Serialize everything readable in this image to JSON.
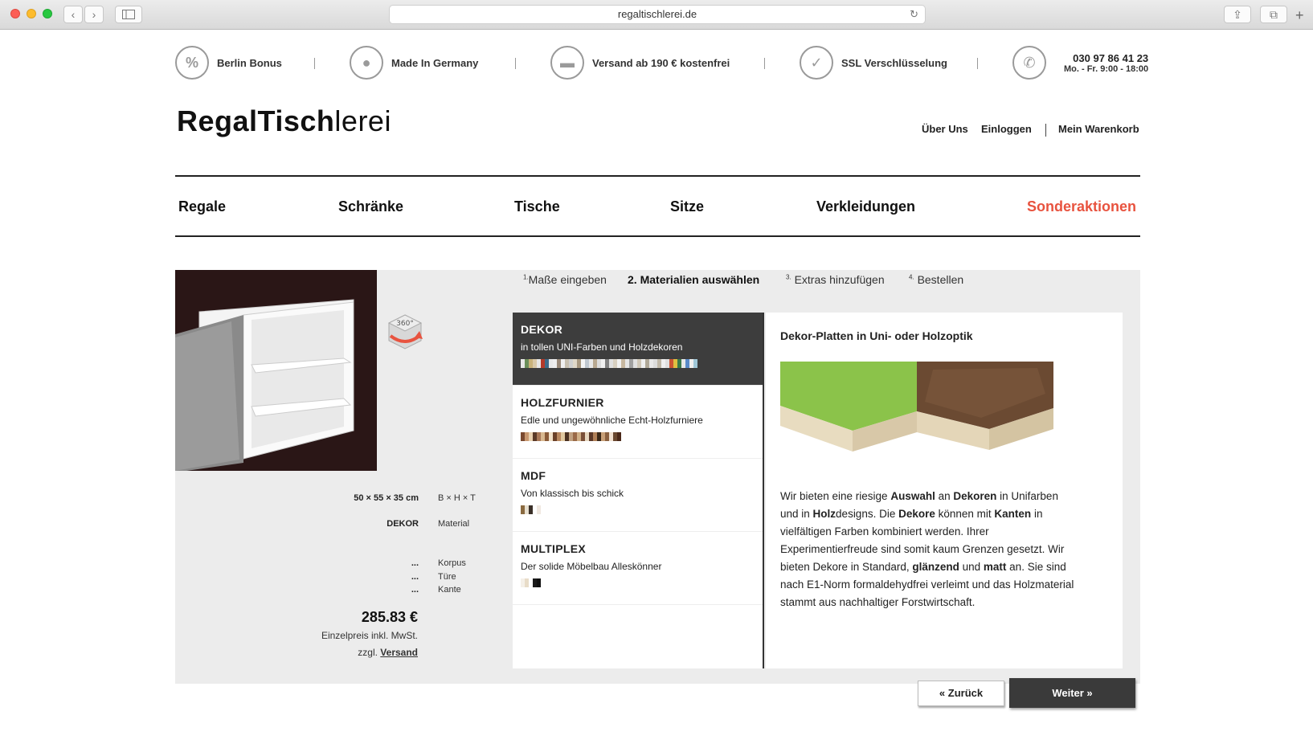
{
  "browser": {
    "url": "regaltischlerei.de",
    "back_icon": "‹",
    "forward_icon": "›",
    "reload_icon": "↻",
    "share_icon": "⇪",
    "tabs_icon": "⧉",
    "new_tab_icon": "+"
  },
  "trust_bar": [
    {
      "icon": "percent-icon",
      "glyph": "%",
      "label": "Berlin Bonus"
    },
    {
      "icon": "germany-icon",
      "glyph": "●",
      "label": "Made In Germany"
    },
    {
      "icon": "truck-icon",
      "glyph": "▬",
      "label": "Versand ab 190 € kostenfrei"
    },
    {
      "icon": "check-icon",
      "glyph": "✓",
      "label": "SSL Verschlüsselung"
    },
    {
      "icon": "phone-icon",
      "glyph": "✆",
      "label": "030 97 86 41 23",
      "sub": "Mo. - Fr. 9:00 - 18:00"
    }
  ],
  "logo": {
    "part1": "RegalTisch",
    "part2": "lerei"
  },
  "account": {
    "about": "Über Uns",
    "login": "Einloggen",
    "cart": "Mein Warenkorb"
  },
  "nav": [
    "Regale",
    "Schränke",
    "Tische",
    "Sitze",
    "Verkleidungen",
    "Sonderaktionen"
  ],
  "steps": [
    {
      "num": "1.",
      "label": "Maße eingeben"
    },
    {
      "num": "2.",
      "label": "Materialien auswählen"
    },
    {
      "num": "3.",
      "label": "Extras hinzufügen"
    },
    {
      "num": "4.",
      "label": "Bestellen"
    }
  ],
  "specs": {
    "dimensions": "50 × 55 × 35 cm",
    "dimensions_label": "B × H × T",
    "material": "DEKOR",
    "material_label": "Material",
    "korpus": "...",
    "korpus_label": "Korpus",
    "tuere": "...",
    "tuere_label": "Türe",
    "kante": "...",
    "kante_label": "Kante"
  },
  "price": {
    "amount": "285.83 €",
    "note": "Einzelpreis inkl. MwSt.",
    "shipping_prefix": "zzgl.",
    "shipping_link": "Versand"
  },
  "materials": [
    {
      "title": "DEKOR",
      "desc": "in tollen UNI-Farben und Holzdekoren",
      "swatches": [
        "#e8e8e8",
        "#6b8e5a",
        "#c9b27a",
        "#d8c8a8",
        "#e6e6e6",
        "#b43a2a",
        "#3d6b8a",
        "#e9e9e9",
        "#eeeeee",
        "#9a8a7a",
        "#f0f0f0",
        "#c8c0b0",
        "#d0d0d0",
        "#e0d8c8",
        "#a89880",
        "#f5f5f5",
        "#c0c8d0",
        "#e8e8e8",
        "#b8a890",
        "#dcdcdc",
        "#f0f0f0",
        "#808080",
        "#e0e0e0",
        "#d8d0c0",
        "#f2f2f2",
        "#c8b8a0",
        "#e6e6e6",
        "#a0a0a0",
        "#e0e0e0",
        "#d0c8b8",
        "#f0f0f0",
        "#b0a898",
        "#e8e8e8",
        "#dcdcdc",
        "#c0b8a8",
        "#f0f0f0",
        "#e0e0e0",
        "#cc5533",
        "#e0c040",
        "#3a7a4a",
        "#e8e8e8",
        "#5a8ac8",
        "#f0f0f0",
        "#a0c8d8"
      ]
    },
    {
      "title": "HOLZFURNIER",
      "desc": "Edle und ungewöhnliche Echt-Holzfurniere",
      "swatches": [
        "#7a4a30",
        "#c89870",
        "#e8d0b0",
        "#5a3a28",
        "#a87858",
        "#d8b890",
        "#8a5a38",
        "#f0e0c8",
        "#6a4028",
        "#b88860",
        "#e0c8a0",
        "#4a3020",
        "#c0a080",
        "#9a6a48",
        "#d0b088",
        "#7a5038",
        "#e8d8c0",
        "#5a3828",
        "#b08058",
        "#3a2818",
        "#c8a078",
        "#8a6040",
        "#f0e0d0",
        "#6a4830",
        "#4a2818"
      ]
    },
    {
      "title": "MDF",
      "desc": "Von klassisch bis schick",
      "swatches": [
        "#8a6a40",
        "#e8e0d0",
        "#3a3028",
        "#ffffff",
        "#f0e8e0"
      ]
    },
    {
      "title": "MULTIPLEX",
      "desc": "Der solide Möbelbau Alleskönner",
      "swatches": [
        "#f5f0e8",
        "#e8dcc8",
        "#ffffff",
        "#1a1a1a",
        "#101010"
      ]
    }
  ],
  "info": {
    "title": "Dekor-Platten in Uni- oder Holzoptik",
    "text": [
      {
        "t": "Wir bieten eine riesige ",
        "b": false
      },
      {
        "t": "Auswahl",
        "b": true
      },
      {
        "t": " an ",
        "b": false
      },
      {
        "t": "Dekoren",
        "b": true
      },
      {
        "t": " in Unifarben und in ",
        "b": false
      },
      {
        "t": "Holz",
        "b": true
      },
      {
        "t": "designs. Die ",
        "b": false
      },
      {
        "t": "Dekore",
        "b": true
      },
      {
        "t": " können mit ",
        "b": false
      },
      {
        "t": "Kanten",
        "b": true
      },
      {
        "t": " in vielfältigen Farben kombiniert werden. Ihrer Experimentierfreude sind somit kaum Grenzen gesetzt. Wir bieten Dekore in Standard, ",
        "b": false
      },
      {
        "t": "glänzend",
        "b": true
      },
      {
        "t": " und ",
        "b": false
      },
      {
        "t": "matt",
        "b": true
      },
      {
        "t": " an. Sie sind nach E1-Norm formaldehydfrei verleimt und das Holzmaterial stammt aus nachhaltiger Forstwirtschaft.",
        "b": false
      }
    ]
  },
  "buttons": {
    "back": "« Zurück",
    "next": "Weiter »"
  },
  "colors": {
    "accent": "#e8533f",
    "dark": "#3d3d3d",
    "preview_bg": "#2a1616",
    "board_green": "#8bc34a"
  },
  "rotate_badge": "360°"
}
